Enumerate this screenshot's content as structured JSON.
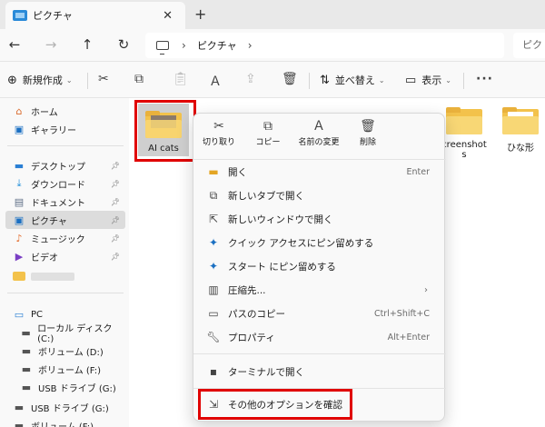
{
  "window": {
    "tab_title": "ピクチャ",
    "tab_close": "✕",
    "tab_add": "+"
  },
  "nav": {
    "back": "←",
    "forward": "→",
    "up": "↑",
    "refresh": "↻",
    "crumb_sep": "›",
    "breadcrumb": [
      "ピクチャ"
    ],
    "search_placeholder": "ピクチャの検索"
  },
  "commandbar": {
    "new_label": "新規作成",
    "sort_label": "並べ替え",
    "view_label": "表示",
    "more": "···"
  },
  "sidebar": {
    "quick": [
      {
        "label": "ホーム",
        "icon": "home-icon"
      },
      {
        "label": "ギャラリー",
        "icon": "gallery-icon"
      }
    ],
    "pinned": [
      {
        "label": "デスクトップ",
        "icon": "desktop-icon"
      },
      {
        "label": "ダウンロード",
        "icon": "download-icon"
      },
      {
        "label": "ドキュメント",
        "icon": "document-icon"
      },
      {
        "label": "ピクチャ",
        "icon": "pictures-icon"
      },
      {
        "label": "ミュージック",
        "icon": "music-icon"
      },
      {
        "label": "ビデオ",
        "icon": "video-icon"
      }
    ],
    "pc_label": "PC",
    "drives": [
      {
        "label": "ローカル ディスク (C:)"
      },
      {
        "label": "ボリューム (D:)"
      },
      {
        "label": "ボリューム (F:)"
      },
      {
        "label": "USB ドライブ (G:)"
      }
    ],
    "bottom": [
      {
        "label": "USB ドライブ (G:)"
      },
      {
        "label": "ボリューム (F:)"
      }
    ]
  },
  "content": {
    "selected_folder": "AI cats",
    "folders": [
      {
        "label_line1": "creenshot",
        "label_line2": "s"
      },
      {
        "label_line1": "ひな形",
        "label_line2": ""
      }
    ]
  },
  "context_menu": {
    "top_actions": [
      {
        "label": "切り取り",
        "icon": "cut-icon"
      },
      {
        "label": "コピー",
        "icon": "copy-icon"
      },
      {
        "label": "名前の変更",
        "icon": "rename-icon"
      },
      {
        "label": "削除",
        "icon": "delete-icon"
      }
    ],
    "items": [
      {
        "label": "開く",
        "shortcut": "Enter",
        "icon": "open-icon"
      },
      {
        "label": "新しいタブで開く",
        "shortcut": "",
        "icon": "new-tab-icon"
      },
      {
        "label": "新しいウィンドウで開く",
        "shortcut": "",
        "icon": "new-window-icon"
      },
      {
        "label": "クイック アクセスにピン留めする",
        "shortcut": "",
        "icon": "pin-icon"
      },
      {
        "label": "スタート にピン留めする",
        "shortcut": "",
        "icon": "pin-start-icon"
      },
      {
        "label": "圧縮先...",
        "shortcut": "",
        "icon": "compress-icon"
      },
      {
        "label": "パスのコピー",
        "shortcut": "Ctrl+Shift+C",
        "icon": "copy-path-icon"
      },
      {
        "label": "プロパティ",
        "shortcut": "Alt+Enter",
        "icon": "properties-icon"
      },
      {
        "label": "ターミナルで開く",
        "shortcut": "",
        "icon": "terminal-icon"
      },
      {
        "label": "その他のオプションを確認",
        "shortcut": "",
        "icon": "more-options-icon"
      }
    ],
    "submenu_arrow": "›"
  },
  "colors": {
    "highlight": "#e00000",
    "folder": "#f3c24b",
    "selected": "#dcdcdc"
  }
}
